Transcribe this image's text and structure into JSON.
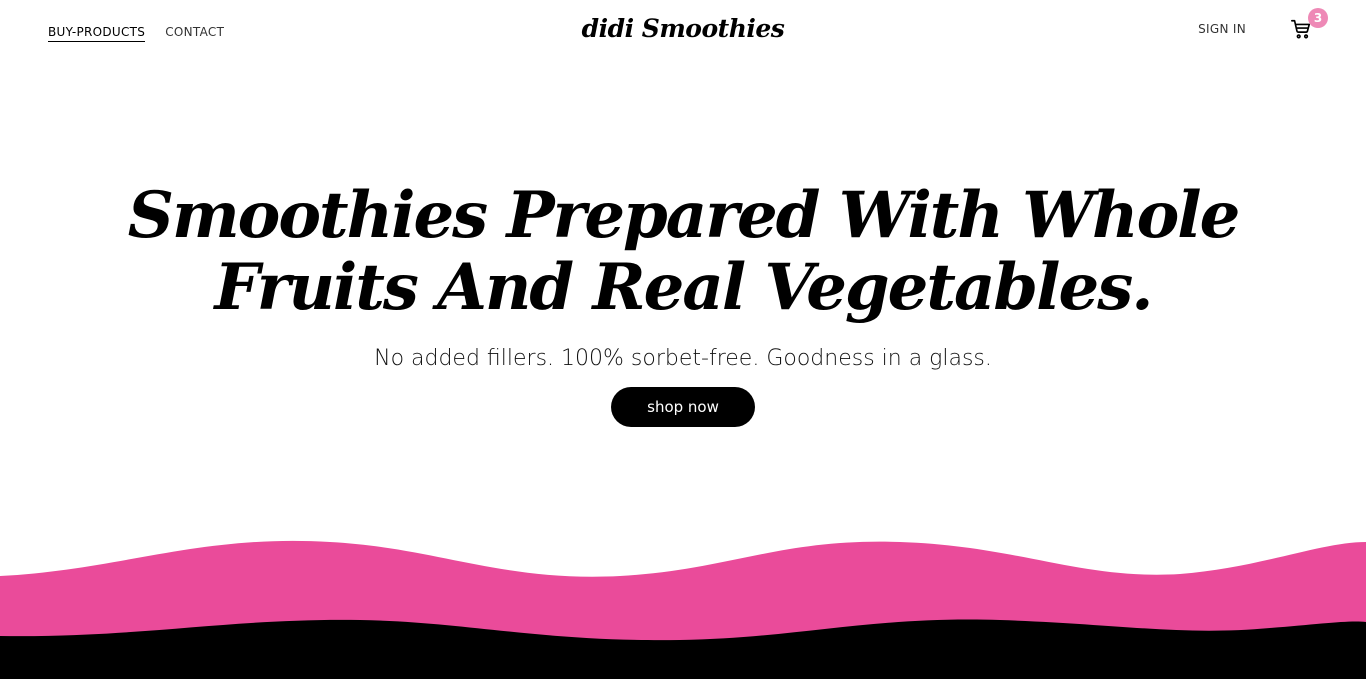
{
  "nav": {
    "links": [
      {
        "label": "BUY-PRODUCTS",
        "active": true
      },
      {
        "label": "CONTACT",
        "active": false
      }
    ],
    "logo": "didi Smoothies",
    "signin_label": "SIGN IN",
    "cart_count": "3"
  },
  "hero": {
    "title": "Smoothies Prepared With Whole Fruits And Real Vegetables.",
    "subtitle": "No added fillers. 100% sorbet-free. Goodness in a glass.",
    "cta_label": "shop now"
  },
  "colors": {
    "accent_pink": "#ea4b9a",
    "badge_pink": "#ee89b6",
    "dark": "#000000"
  },
  "icons": {
    "cart": "cart-icon"
  }
}
